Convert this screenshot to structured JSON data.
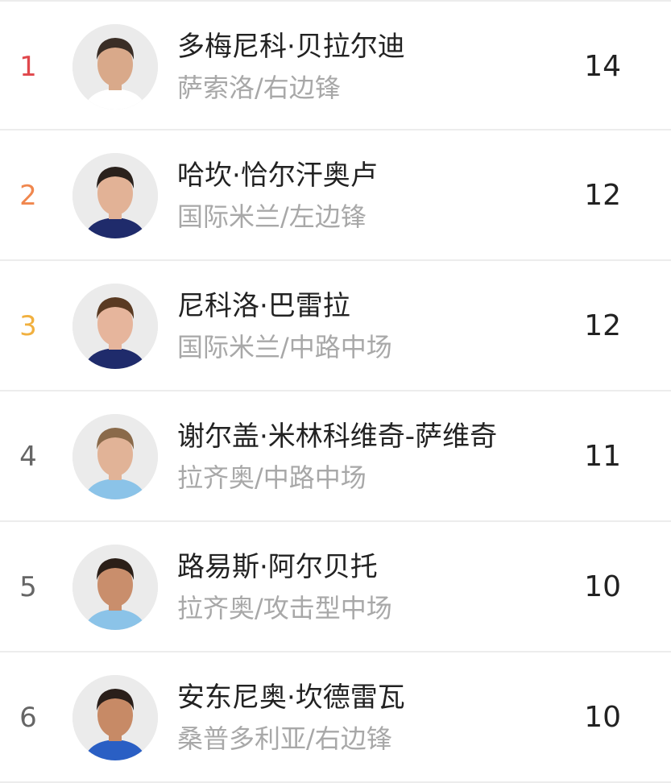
{
  "rows": [
    {
      "rank": "1",
      "name": "多梅尼科·贝拉尔迪",
      "sub": "萨索洛/右边锋",
      "score": "14",
      "rank_color": "#e0474c",
      "shirt": "#ffffff",
      "skin": "#d9a98a",
      "hair": "#3a2e26"
    },
    {
      "rank": "2",
      "name": "哈坎·恰尔汗奥卢",
      "sub": "国际米兰/左边锋",
      "score": "12",
      "rank_color": "#f0874e",
      "shirt": "#1f2b6b",
      "skin": "#e2b296",
      "hair": "#2a211c"
    },
    {
      "rank": "3",
      "name": "尼科洛·巴雷拉",
      "sub": "国际米兰/中路中场",
      "score": "12",
      "rank_color": "#f1b03f",
      "shirt": "#1f2b6b",
      "skin": "#e6b59c",
      "hair": "#5a3a22"
    },
    {
      "rank": "4",
      "name": "谢尔盖·米林科维奇-萨维奇",
      "sub": "拉齐奥/中路中场",
      "score": "11",
      "rank_color": "#666666",
      "shirt": "#8bc3e8",
      "skin": "#e1b397",
      "hair": "#8a6a4a"
    },
    {
      "rank": "5",
      "name": "路易斯·阿尔贝托",
      "sub": "拉齐奥/攻击型中场",
      "score": "10",
      "rank_color": "#666666",
      "shirt": "#8bc3e8",
      "skin": "#c98e6c",
      "hair": "#2b1f18"
    },
    {
      "rank": "6",
      "name": "安东尼奥·坎德雷瓦",
      "sub": "桑普多利亚/右边锋",
      "score": "10",
      "rank_color": "#666666",
      "shirt": "#2a5fc4",
      "skin": "#c78a66",
      "hair": "#2a1f1a"
    }
  ]
}
